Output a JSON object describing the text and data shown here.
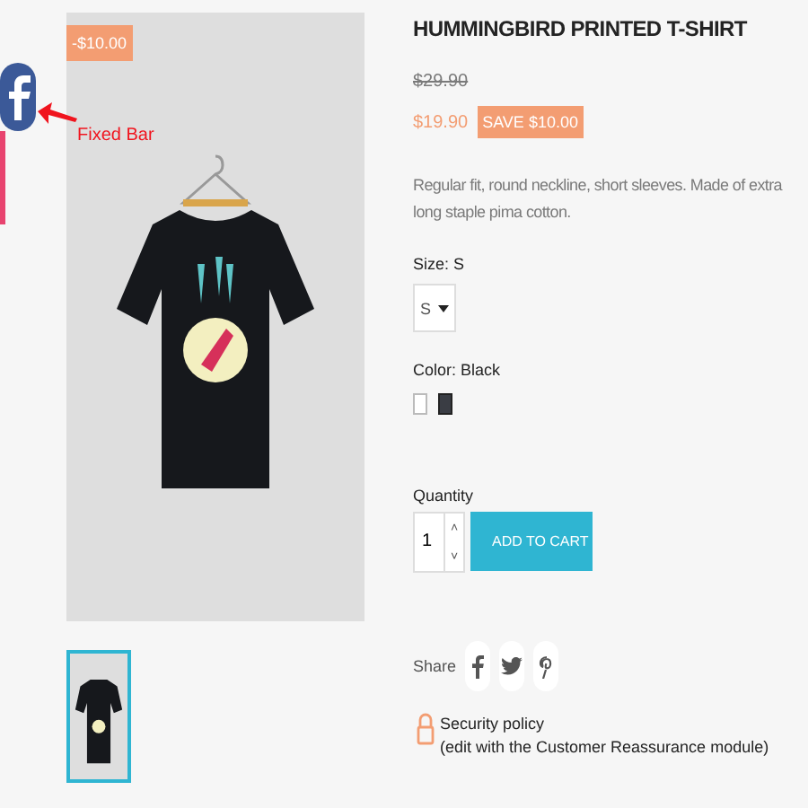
{
  "fixed_bar": {
    "annotation": "Fixed Bar"
  },
  "product_image": {
    "discount_badge": "-$10.00"
  },
  "thumbnails": [
    {
      "selected": true
    }
  ],
  "product": {
    "title": "HUMMINGBIRD PRINTED T-SHIRT",
    "old_price": "$29.90",
    "price": "$19.90",
    "save_badge": "SAVE $10.00",
    "description": "Regular fit, round neckline, short sleeves. Made of extra long staple pima cotton."
  },
  "size": {
    "label": "Size: S",
    "value": "S"
  },
  "color": {
    "label": "Color: Black",
    "swatches": [
      {
        "color": "#ffffff",
        "selected": false
      },
      {
        "color": "#3a3d44",
        "selected": true
      }
    ]
  },
  "quantity": {
    "label": "Quantity",
    "value": "1",
    "up": "˄",
    "down": "˅"
  },
  "add_to_cart": {
    "label": "ADD TO CART"
  },
  "share": {
    "label": "Share",
    "networks": [
      {
        "kind": "facebook"
      },
      {
        "kind": "twitter"
      },
      {
        "kind": "pinterest"
      }
    ]
  },
  "reassurance": {
    "title": "Security policy",
    "note": "(edit with the Customer Reassurance module)"
  }
}
